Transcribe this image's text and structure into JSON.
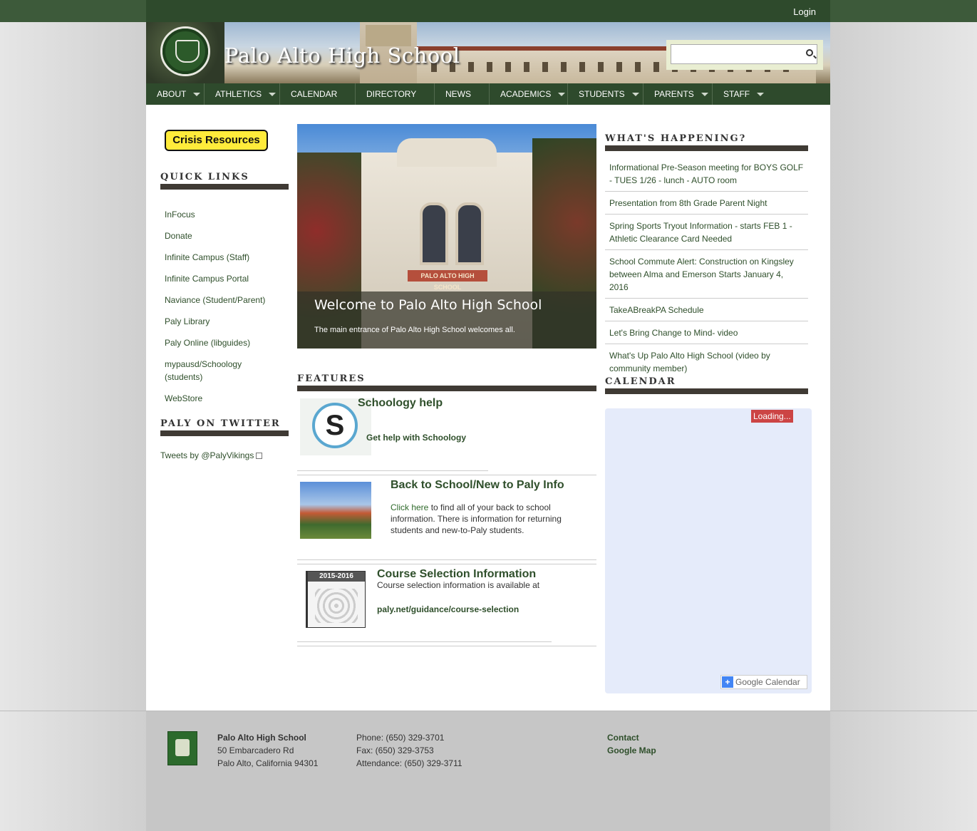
{
  "topbar": {
    "login": "Login"
  },
  "header": {
    "title": "Palo Alto High School",
    "search_placeholder": ""
  },
  "nav": [
    {
      "label": "ABOUT",
      "has_menu": true
    },
    {
      "label": "ATHLETICS",
      "has_menu": true
    },
    {
      "label": "CALENDAR",
      "has_menu": false
    },
    {
      "label": "DIRECTORY",
      "has_menu": false
    },
    {
      "label": "NEWS",
      "has_menu": false
    },
    {
      "label": "ACADEMICS",
      "has_menu": true
    },
    {
      "label": "STUDENTS",
      "has_menu": true
    },
    {
      "label": "PARENTS",
      "has_menu": true
    },
    {
      "label": "STAFF",
      "has_menu": true
    }
  ],
  "left": {
    "crisis_button": "Crisis Resources",
    "quick_links_heading": "QUICK LINKS",
    "quick_links": [
      "InFocus",
      "Donate",
      "Infinite Campus (Staff)",
      "Infinite Campus Portal",
      "Naviance (Student/Parent)",
      "Paly Library",
      "Paly Online (libguides)",
      "mypausd/Schoology (students)",
      "WebStore"
    ],
    "twitter_heading": "PALY ON TWITTER",
    "twitter_link": "Tweets by @PalyVikings"
  },
  "slideshow": {
    "plaque": "PALO ALTO HIGH SCHOOL",
    "title": "Welcome to Palo Alto High School",
    "text": "The main entrance of Palo Alto High School welcomes all."
  },
  "features": {
    "heading": "FEATURES",
    "items": [
      {
        "title": "Schoology help",
        "link": "Get help with Schoology",
        "icon_letter": "S"
      },
      {
        "title": "Back to School/New to Paly Info",
        "link": "Click here",
        "text": "to find all of your back to school information. There is information for returning students and new-to-Paly students."
      },
      {
        "title": "Course Selection Information",
        "text": "Course selection information is available at",
        "link": "paly.net/guidance/course-selection",
        "thumb_label": "2015-2016"
      }
    ]
  },
  "right": {
    "happening_heading": "WHAT'S HAPPENING?",
    "news": [
      "Informational Pre-Season meeting for BOYS GOLF - TUES 1/26 - lunch - AUTO room",
      "Presentation from 8th Grade Parent Night",
      "Spring Sports Tryout Information - starts FEB 1 - Athletic Clearance Card Needed",
      "School Commute Alert: Construction on Kingsley between Alma and Emerson Starts January 4, 2016",
      "TakeABreakPA Schedule",
      "Let's Bring Change to Mind- video",
      "What's Up Palo Alto High School (video by community member)"
    ],
    "calendar_heading": "CALENDAR",
    "calendar_loading": "Loading...",
    "google_calendar": "Google Calendar",
    "plus": "+"
  },
  "footer": {
    "name": "Palo Alto High School",
    "address1": "50 Embarcadero Rd",
    "address2": "Palo Alto, California 94301",
    "phone": "Phone: (650) 329-3701",
    "fax": "Fax: (650) 329-3753",
    "attendance": "Attendance: (650) 329-3711",
    "contact": "Contact",
    "map": "Google Map"
  },
  "colors": {
    "brand_green": "#2e4a2c",
    "link_green": "#2f4f2b",
    "crisis_yellow": "#ffeb3b"
  }
}
